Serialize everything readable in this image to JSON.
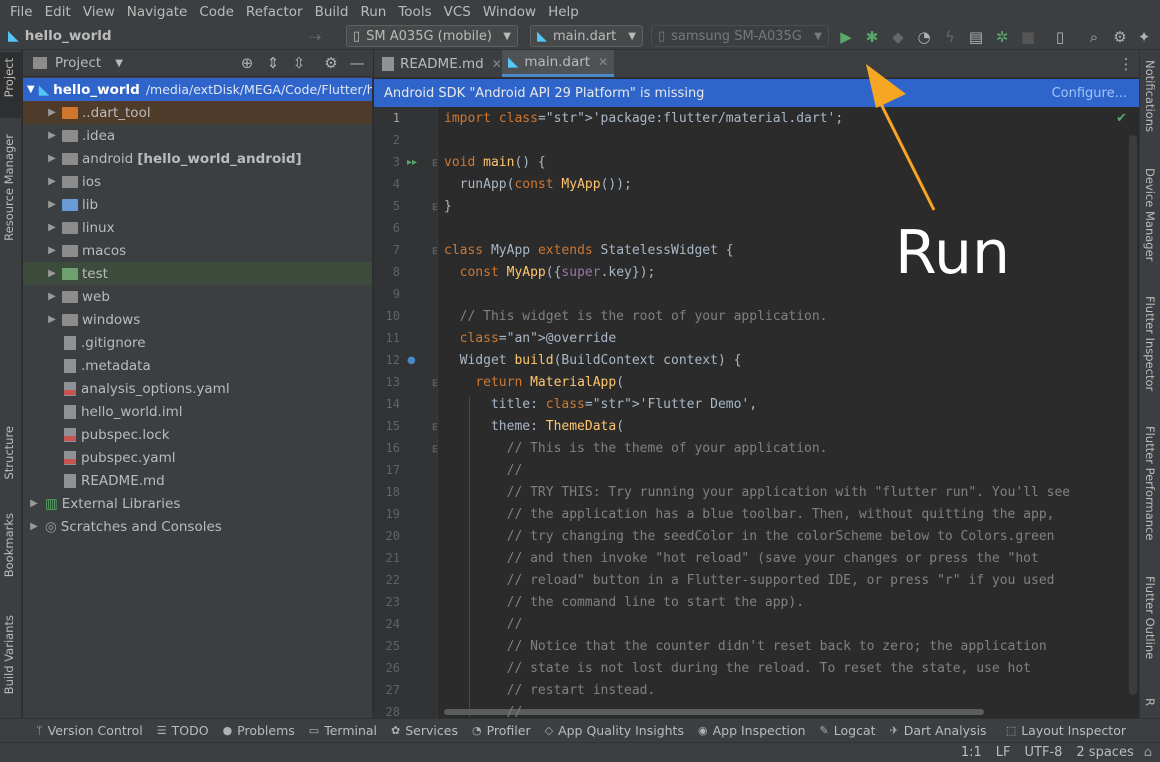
{
  "menu": [
    "File",
    "Edit",
    "View",
    "Navigate",
    "Code",
    "Refactor",
    "Build",
    "Run",
    "Tools",
    "VCS",
    "Window",
    "Help"
  ],
  "toolbar": {
    "project_name": "hello_world",
    "device": "SM A035G (mobile)",
    "config": "main.dart",
    "target_device": "samsung SM-A035G"
  },
  "left_stripe": [
    "Project",
    "Resource Manager",
    "Structure",
    "Bookmarks",
    "Build Variants"
  ],
  "right_stripe": [
    "Notifications",
    "Device Manager",
    "Flutter Inspector",
    "Flutter Performance",
    "Flutter Outline",
    "R"
  ],
  "project_panel": {
    "title": "Project",
    "root": {
      "name": "hello_world",
      "path": "/media/extDisk/MEGA/Code/Flutter/he"
    },
    "items": [
      {
        "label": "..dart_tool",
        "type": "folder",
        "color": "#d0772d"
      },
      {
        "label": ".idea",
        "type": "folder",
        "color": "#8c8c8c"
      },
      {
        "label": "android",
        "bold": "[hello_world_android]",
        "type": "folder",
        "color": "#8c8c8c"
      },
      {
        "label": "ios",
        "type": "folder",
        "color": "#8c8c8c"
      },
      {
        "label": "lib",
        "type": "folder",
        "color": "#6a9bd8"
      },
      {
        "label": "linux",
        "type": "folder",
        "color": "#8c8c8c"
      },
      {
        "label": "macos",
        "type": "folder",
        "color": "#8c8c8c"
      },
      {
        "label": "test",
        "type": "folder",
        "color": "#6fa16f"
      },
      {
        "label": "web",
        "type": "folder",
        "color": "#8c8c8c"
      },
      {
        "label": "windows",
        "type": "folder",
        "color": "#8c8c8c"
      },
      {
        "label": ".gitignore",
        "type": "file"
      },
      {
        "label": ".metadata",
        "type": "file"
      },
      {
        "label": "analysis_options.yaml",
        "type": "yfile"
      },
      {
        "label": "hello_world.iml",
        "type": "file"
      },
      {
        "label": "pubspec.lock",
        "type": "yfile"
      },
      {
        "label": "pubspec.yaml",
        "type": "yfile"
      },
      {
        "label": "README.md",
        "type": "file"
      },
      {
        "label": "External Libraries",
        "type": "lib"
      },
      {
        "label": "Scratches and Consoles",
        "type": "scratch"
      }
    ]
  },
  "tabs": [
    {
      "label": "README.md"
    },
    {
      "label": "main.dart"
    }
  ],
  "banner": {
    "message": "Android SDK \"Android API 29 Platform\" is missing",
    "action": "Configure..."
  },
  "code_lines": [
    "import 'package:flutter/material.dart';",
    "",
    "void main() {",
    "  runApp(const MyApp());",
    "}",
    "",
    "class MyApp extends StatelessWidget {",
    "  const MyApp({super.key});",
    "",
    "  // This widget is the root of your application.",
    "  @override",
    "  Widget build(BuildContext context) {",
    "    return MaterialApp(",
    "      title: 'Flutter Demo',",
    "      theme: ThemeData(",
    "        // This is the theme of your application.",
    "        //",
    "        // TRY THIS: Try running your application with \"flutter run\". You'll see",
    "        // the application has a blue toolbar. Then, without quitting the app,",
    "        // try changing the seedColor in the colorScheme below to Colors.green",
    "        // and then invoke \"hot reload\" (save your changes or press the \"hot",
    "        // reload\" button in a Flutter-supported IDE, or press \"r\" if you used",
    "        // the command line to start the app).",
    "        //",
    "        // Notice that the counter didn't reset back to zero; the application",
    "        // state is not lost during the reload. To reset the state, use hot",
    "        // restart instead.",
    "        //"
  ],
  "line_numbers": [
    "1",
    "2",
    "3",
    "4",
    "5",
    "6",
    "7",
    "8",
    "9",
    "10",
    "11",
    "12",
    "13",
    "14",
    "15",
    "16",
    "17",
    "18",
    "19",
    "20",
    "21",
    "22",
    "23",
    "24",
    "25",
    "26",
    "27",
    "28"
  ],
  "bottom_tools": [
    {
      "label": "Version Control",
      "icon": "branch-icon"
    },
    {
      "label": "TODO",
      "icon": "list-icon"
    },
    {
      "label": "Problems",
      "icon": "warning-icon"
    },
    {
      "label": "Terminal",
      "icon": "terminal-icon"
    },
    {
      "label": "Services",
      "icon": "services-icon"
    },
    {
      "label": "Profiler",
      "icon": "gauge-icon"
    },
    {
      "label": "App Quality Insights",
      "icon": "diamond-icon"
    },
    {
      "label": "App Inspection",
      "icon": "inspect-icon"
    },
    {
      "label": "Logcat",
      "icon": "cat-icon"
    },
    {
      "label": "Dart Analysis",
      "icon": "dart-icon"
    },
    {
      "label": "Layout Inspector",
      "icon": "layout-icon"
    }
  ],
  "status": {
    "position": "1:1",
    "line_sep": "LF",
    "encoding": "UTF-8",
    "indent": "2 spaces"
  },
  "annotation": {
    "text": "Run",
    "arrow_color": "#f5a623"
  },
  "colors": {
    "banner": "#2f65ca",
    "run": "#59a869",
    "selection": "#2f65ca"
  }
}
